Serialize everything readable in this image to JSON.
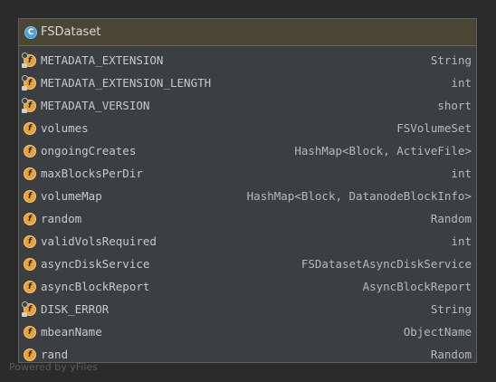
{
  "class": {
    "icon_letter": "C",
    "name": "FSDataset"
  },
  "fields": [
    {
      "name": "METADATA_EXTENSION",
      "type": "String",
      "static_final": true
    },
    {
      "name": "METADATA_EXTENSION_LENGTH",
      "type": "int",
      "static_final": true
    },
    {
      "name": "METADATA_VERSION",
      "type": "short",
      "static_final": true
    },
    {
      "name": "volumes",
      "type": "FSVolumeSet",
      "static_final": false
    },
    {
      "name": "ongoingCreates",
      "type": "HashMap<Block, ActiveFile>",
      "static_final": false
    },
    {
      "name": "maxBlocksPerDir",
      "type": "int",
      "static_final": false
    },
    {
      "name": "volumeMap",
      "type": "HashMap<Block, DatanodeBlockInfo>",
      "static_final": false
    },
    {
      "name": "random",
      "type": "Random",
      "static_final": false
    },
    {
      "name": "validVolsRequired",
      "type": "int",
      "static_final": false
    },
    {
      "name": "asyncDiskService",
      "type": "FSDatasetAsyncDiskService",
      "static_final": false
    },
    {
      "name": "asyncBlockReport",
      "type": "AsyncBlockReport",
      "static_final": false
    },
    {
      "name": "DISK_ERROR",
      "type": "String",
      "static_final": true
    },
    {
      "name": "mbeanName",
      "type": "ObjectName",
      "static_final": false
    },
    {
      "name": "rand",
      "type": "Random",
      "static_final": false
    }
  ],
  "field_icon_letter": "f",
  "watermark": "Powered by yFiles",
  "colors": {
    "background": "#2b2b2b",
    "header": "#4a4633",
    "class_icon": "#4d9fd6",
    "field_icon": "#e8a23c"
  }
}
